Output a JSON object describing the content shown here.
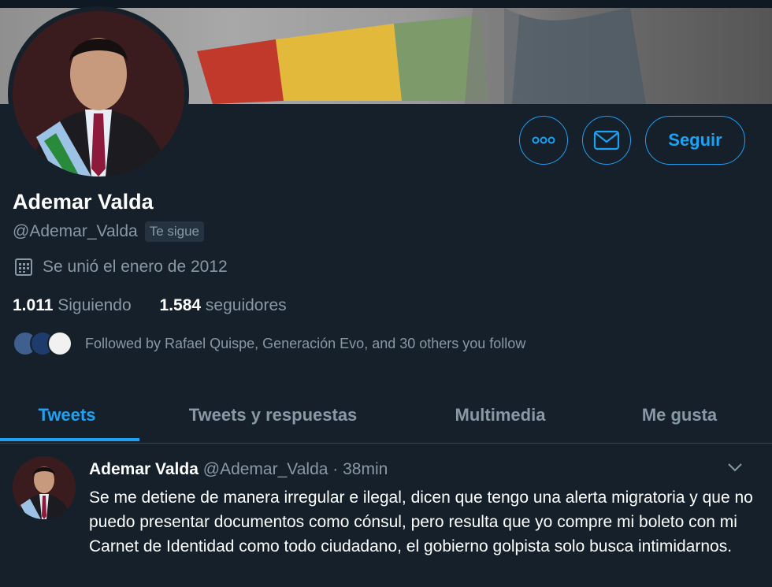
{
  "profile": {
    "name": "Ademar Valda",
    "handle": "@Ademar_Valda",
    "follows_you_badge": "Te sigue",
    "joined": "Se unió el enero de 2012",
    "following_count": "1.011",
    "following_label": "Siguiendo",
    "followers_count": "1.584",
    "followers_label": "seguidores",
    "followed_by": "Followed by Rafael Quispe, Generación Evo, and 30 others you follow"
  },
  "actions": {
    "more_icon": "more-icon",
    "message_icon": "mail-icon",
    "follow_label": "Seguir"
  },
  "tabs": [
    {
      "label": "Tweets",
      "active": true
    },
    {
      "label": "Tweets y respuestas",
      "active": false
    },
    {
      "label": "Multimedia",
      "active": false
    },
    {
      "label": "Me gusta",
      "active": false
    }
  ],
  "tweet": {
    "author_name": "Ademar Valda",
    "author_handle": "@Ademar_Valda",
    "separator": "·",
    "time": "38min",
    "text": "Se me detiene de manera irregular e ilegal, dicen que tengo una alerta migratoria y que no puedo presentar documentos como cónsul,  pero resulta que yo compre mi boleto  con mi Carnet de Identidad como todo ciudadano, el gobierno golpista solo busca intimidarnos."
  },
  "colors": {
    "background": "#15202b",
    "accent": "#1da1f2",
    "muted_text": "#8899a6"
  }
}
